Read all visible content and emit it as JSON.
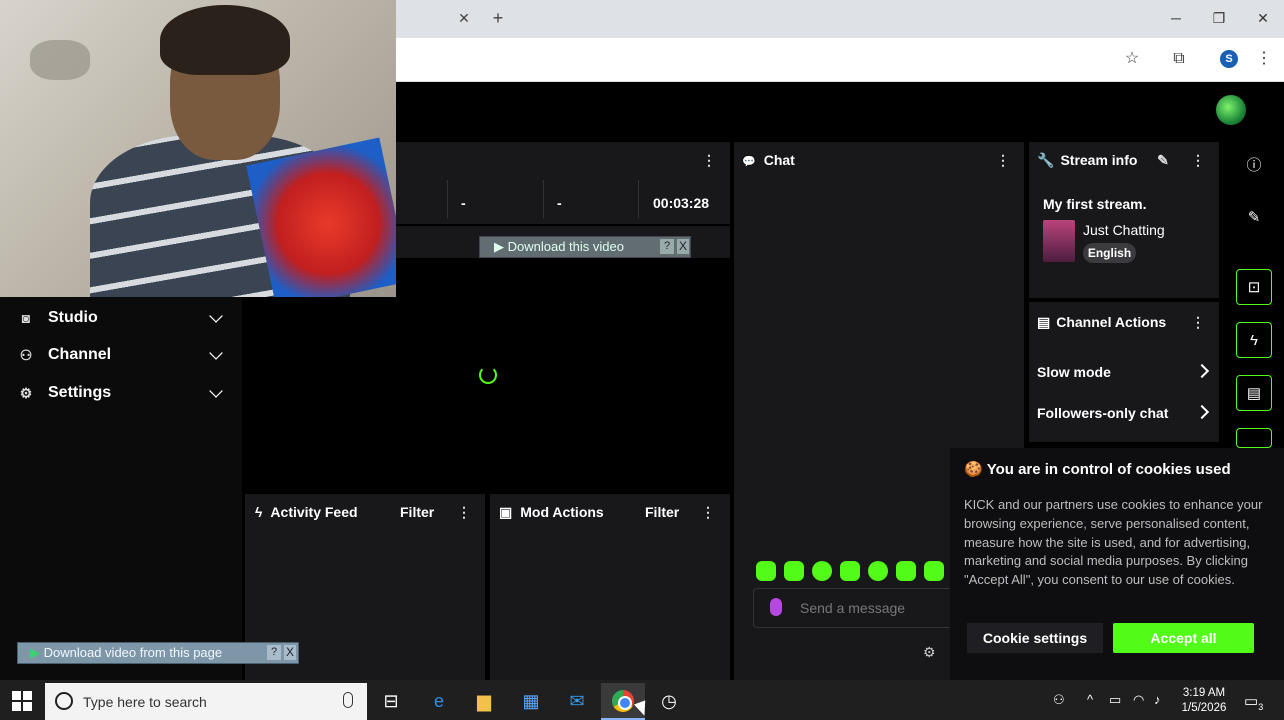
{
  "browser": {
    "tab_close": "✕",
    "tab_new": "+",
    "win_min": "─",
    "win_restore": "❐",
    "win_close": "✕",
    "profile_initial": "S"
  },
  "sidebar": {
    "items": [
      {
        "label": "Studio",
        "icon": "broadcast-icon"
      },
      {
        "label": "Channel",
        "icon": "users-icon"
      },
      {
        "label": "Settings",
        "icon": "gear-icon"
      }
    ]
  },
  "stats": {
    "values": [
      "-",
      "-",
      "00:03:28"
    ]
  },
  "downloader": {
    "video_label": "Download this video",
    "page_label": "Download video from this page",
    "help": "?",
    "close": "X"
  },
  "panels": {
    "activity": {
      "title": "Activity Feed",
      "filter": "Filter"
    },
    "mod": {
      "title": "Mod Actions",
      "filter": "Filter"
    },
    "chat": {
      "title": "Chat",
      "placeholder": "Send a message"
    },
    "stream_info": {
      "title": "Stream info",
      "stream_title": "My first stream.",
      "category": "Just Chatting",
      "language": "English"
    },
    "channel_actions": {
      "title": "Channel Actions",
      "items": [
        "Slow mode",
        "Followers-only chat"
      ]
    }
  },
  "cookie": {
    "title": "You are in control of cookies used",
    "body": "KICK and our partners use cookies to enhance your browsing experience, serve personalised content, measure how the site is used, and for advertising, marketing and social media purposes. By clicking \"Accept All\", you consent to our use of cookies.",
    "settings_label": "Cookie settings",
    "accept_label": "Accept all"
  },
  "taskbar": {
    "search_placeholder": "Type here to search",
    "time": "3:19 AM",
    "date": "1/5/2026",
    "notif_count": "3"
  },
  "colors": {
    "accent": "#53fc18",
    "panel": "#18181b"
  }
}
